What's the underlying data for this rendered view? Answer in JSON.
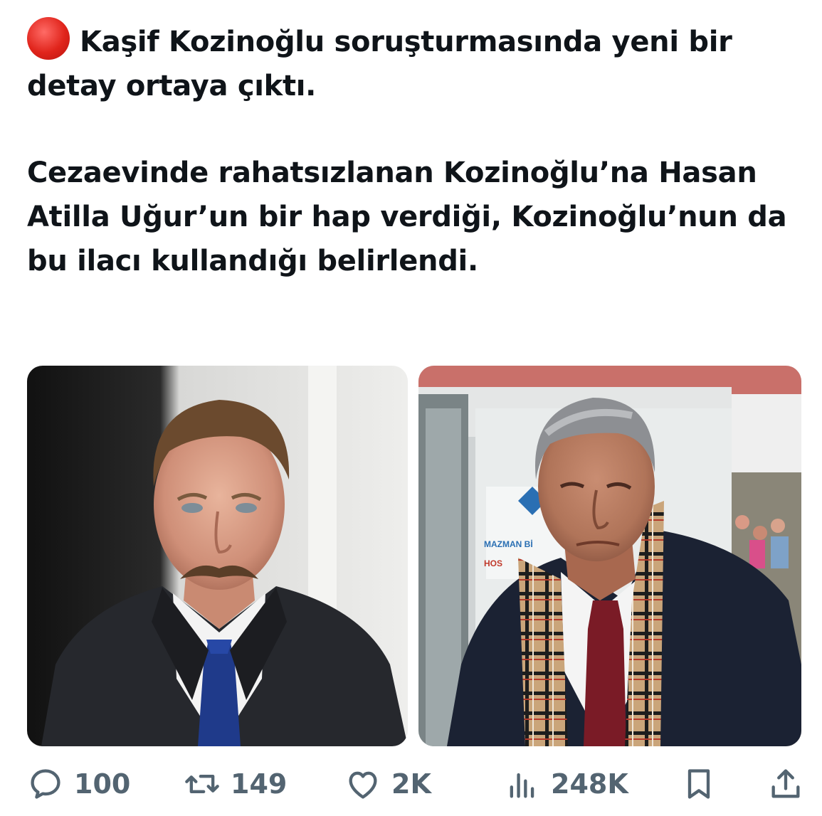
{
  "tweet": {
    "indicator_icon": "red-circle-emoji",
    "indicator_color": "#e0241b",
    "line1_text": "Kaşif Kozinoğlu soruşturmasında yeni bir detay ortaya çıktı.",
    "line2_text": "Cezaevinde rahatsızlanan Kozinoğlu’na Hasan Atilla Uğur’un bir hap verdiği, Kozinoğlu’nun da bu ilacı kullandığı belirlendi."
  },
  "media": {
    "right_photo_sign_line1": "MAZMAN Bİ",
    "right_photo_sign_line2": "HOS"
  },
  "actions": {
    "reply_icon": "reply-icon",
    "reply_count": "100",
    "retweet_icon": "retweet-icon",
    "retweet_count": "149",
    "like_icon": "heart-icon",
    "like_count": "2K",
    "views_icon": "views-icon",
    "views_count": "248K",
    "bookmark_icon": "bookmark-icon",
    "share_icon": "share-icon",
    "icon_color": "#536471"
  }
}
